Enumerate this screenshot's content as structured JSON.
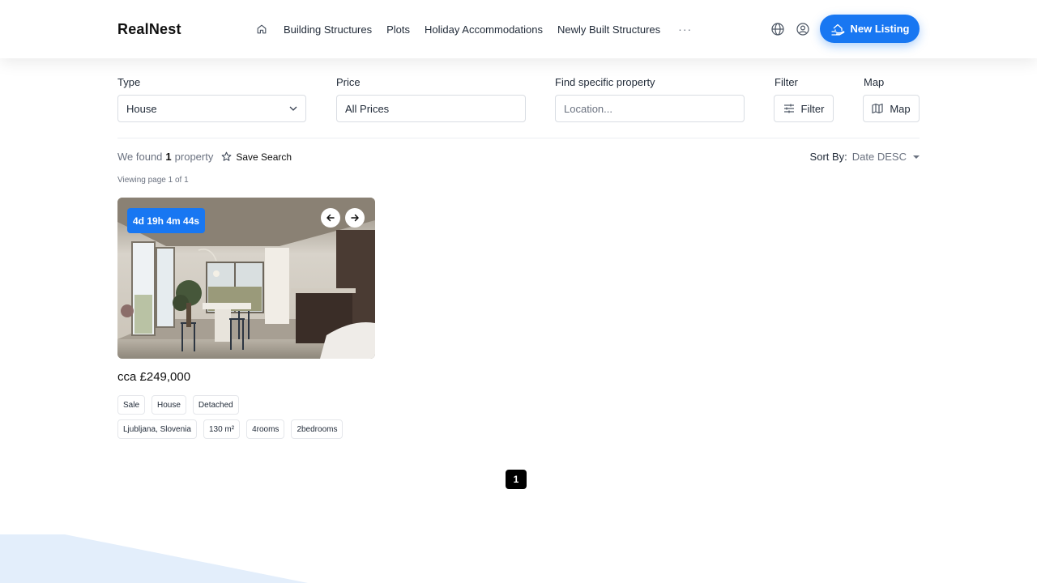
{
  "header": {
    "logo": "RealNest",
    "nav": [
      "Building Structures",
      "Plots",
      "Holiday Accommodations",
      "Newly Built Structures"
    ],
    "more": "···",
    "new_listing": "New Listing",
    "accent": "#1877f2"
  },
  "filters": {
    "type_label": "Type",
    "type_value": "House",
    "price_label": "Price",
    "price_value": "All Prices",
    "find_label": "Find specific property",
    "location_placeholder": "Location...",
    "filter_label": "Filter",
    "filter_button": "Filter",
    "map_label": "Map",
    "map_button": "Map"
  },
  "results": {
    "found_prefix": "We found",
    "count": "1",
    "found_suffix": "property",
    "save_search": "Save Search",
    "sort_label": "Sort By:",
    "sort_value": "Date DESC",
    "viewing": "Viewing page 1 of 1"
  },
  "listing": {
    "countdown": "4d 19h 4m 44s",
    "price": "cca £249,000",
    "tags_row1": [
      "Sale",
      "House",
      "Detached"
    ],
    "tags_row2": [
      "Ljubljana, Slovenia",
      "130 m²",
      "4rooms",
      "2bedrooms"
    ]
  },
  "pagination": {
    "current": "1"
  }
}
